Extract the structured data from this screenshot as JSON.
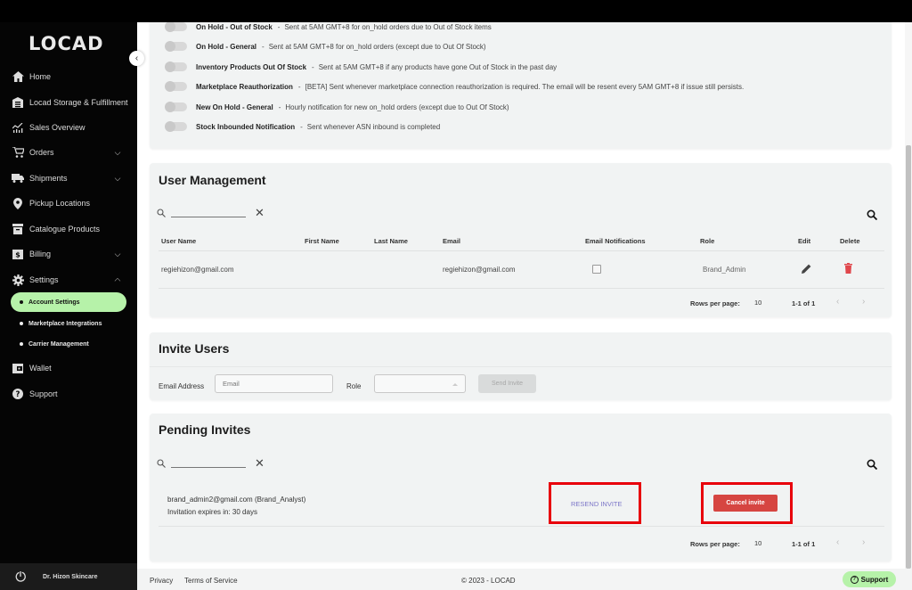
{
  "app": {
    "logo": "LOCAD",
    "brand_accent": "#b6f2a9"
  },
  "sidebar": {
    "items": [
      {
        "label": "Home",
        "icon": "home-icon"
      },
      {
        "label": "Locad Storage & Fulfillment",
        "icon": "warehouse-icon"
      },
      {
        "label": "Sales Overview",
        "icon": "chart-icon"
      },
      {
        "label": "Orders",
        "icon": "cart-icon",
        "expandable": true
      },
      {
        "label": "Shipments",
        "icon": "truck-icon",
        "expandable": true
      },
      {
        "label": "Pickup Locations",
        "icon": "location-pin-icon"
      },
      {
        "label": "Catalogue Products",
        "icon": "archive-box-icon"
      },
      {
        "label": "Billing",
        "icon": "billing-icon",
        "expandable": true
      },
      {
        "label": "Settings",
        "icon": "gear-icon",
        "expanded": true
      },
      {
        "label": "Wallet",
        "icon": "wallet-icon"
      },
      {
        "label": "Support",
        "icon": "help-icon"
      }
    ],
    "settings_sub": [
      {
        "label": "Account Settings",
        "active": true
      },
      {
        "label": "Marketplace Integrations"
      },
      {
        "label": "Carrier Management"
      }
    ],
    "footer": {
      "org_name": "Dr. Hizon Skincare"
    }
  },
  "notifications": [
    {
      "title": "On Hold - Out of Stock",
      "desc": "Sent at 5AM GMT+8 for on_hold orders due to Out of Stock items",
      "enabled": false
    },
    {
      "title": "On Hold - General",
      "desc": "Sent at 5AM GMT+8 for on_hold orders (except due to Out Of Stock)",
      "enabled": false
    },
    {
      "title": "Inventory Products Out Of Stock",
      "desc": "Sent at 5AM GMT+8 if any products have gone Out of Stock in the past day",
      "enabled": false
    },
    {
      "title": "Marketplace Reauthorization",
      "desc": "[BETA] Sent whenever marketplace connection reauthorization is required. The email will be resent every 5AM GMT+8 if issue still persists.",
      "enabled": false
    },
    {
      "title": "New On Hold - General",
      "desc": "Hourly notification for new on_hold orders (except due to Out Of Stock)",
      "enabled": false
    },
    {
      "title": "Stock Inbounded Notification",
      "desc": "Sent whenever ASN inbound is completed",
      "enabled": false
    }
  ],
  "separator": "-",
  "user_management": {
    "title": "User Management",
    "search_value": "",
    "columns": [
      "User Name",
      "First Name",
      "Last Name",
      "Email",
      "Email Notifications",
      "Role",
      "Edit",
      "Delete"
    ],
    "rows": [
      {
        "user_name": "regiehizon@gmail.com",
        "first_name": "",
        "last_name": "",
        "email": "regiehizon@gmail.com",
        "email_notifications": false,
        "role": "Brand_Admin"
      }
    ],
    "rows_per_page_label": "Rows per page:",
    "rows_per_page": "10",
    "range": "1-1 of 1"
  },
  "invite_users": {
    "title": "Invite Users",
    "email_label": "Email Address",
    "email_placeholder": "Email",
    "role_label": "Role",
    "role_value": "",
    "send_label": "Send Invite"
  },
  "pending_invites": {
    "title": "Pending Invites",
    "search_value": "",
    "items": [
      {
        "line1": "brand_admin2@gmail.com (Brand_Analyst)",
        "line2": "Invitation expires in: 30 days",
        "resend_label": "RESEND INVITE",
        "cancel_label": "Cancel invite"
      }
    ],
    "rows_per_page_label": "Rows per page:",
    "rows_per_page": "10",
    "range": "1-1 of 1"
  },
  "footer": {
    "privacy": "Privacy",
    "terms": "Terms of Service",
    "copyright": "© 2023 - LOCAD",
    "support_label": "Support"
  }
}
